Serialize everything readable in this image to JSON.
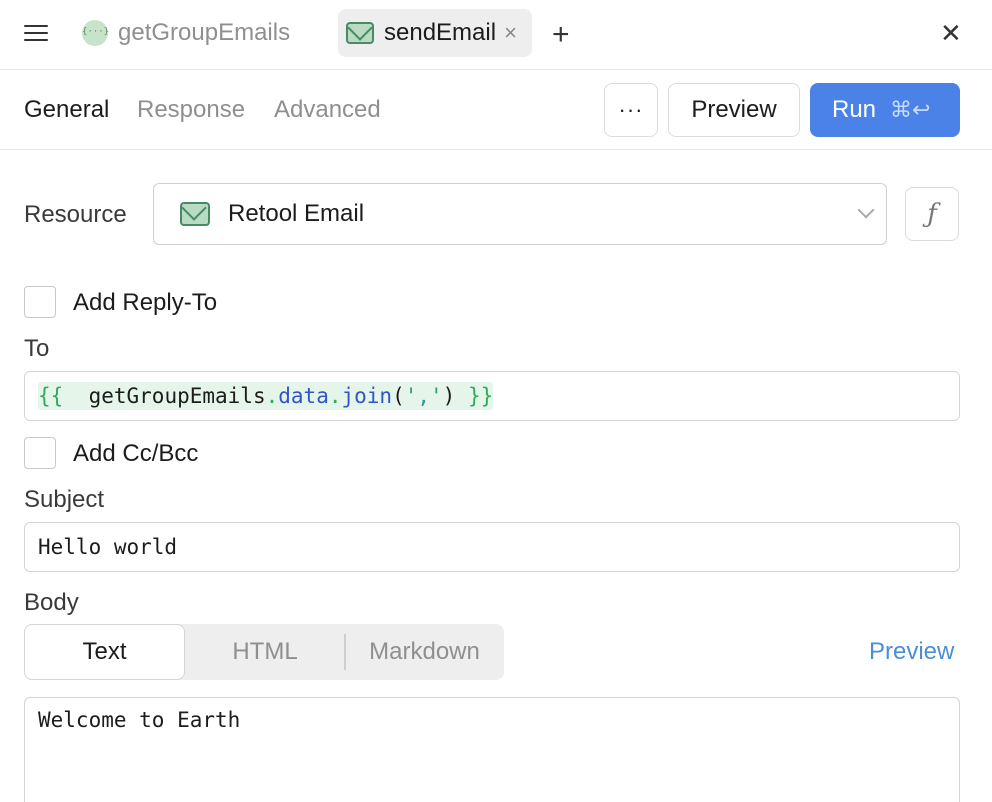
{
  "tabs": [
    {
      "label": "getGroupEmails",
      "icon": "js-query-icon"
    },
    {
      "label": "sendEmail",
      "icon": "mail-icon",
      "active": true
    }
  ],
  "subtabs": {
    "general": "General",
    "response": "Response",
    "advanced": "Advanced"
  },
  "toolbar": {
    "more_label": "···",
    "preview_label": "Preview",
    "run_label": "Run",
    "run_shortcut": "⌘↩"
  },
  "resource": {
    "label": "Resource",
    "value": "Retool Email"
  },
  "reply_to": {
    "label": "Add Reply-To",
    "checked": false
  },
  "to": {
    "label": "To",
    "code": {
      "open": "{{",
      "ident": "getGroupEmails",
      "dot1": ".",
      "prop": "data",
      "dot2": ".",
      "fn": "join",
      "paren_open": "(",
      "arg": "','",
      "paren_close": ")",
      "close": "}}"
    }
  },
  "cc_bcc": {
    "label": "Add Cc/Bcc",
    "checked": false
  },
  "subject": {
    "label": "Subject",
    "value": "Hello world"
  },
  "body": {
    "label": "Body",
    "modes": [
      "Text",
      "HTML",
      "Markdown"
    ],
    "selected_mode": "Text",
    "preview_link": "Preview",
    "value": "Welcome to Earth"
  },
  "colors": {
    "run_button": "#4a82e8",
    "link": "#4a8fd4",
    "code_highlight": "#e6f5ea"
  }
}
